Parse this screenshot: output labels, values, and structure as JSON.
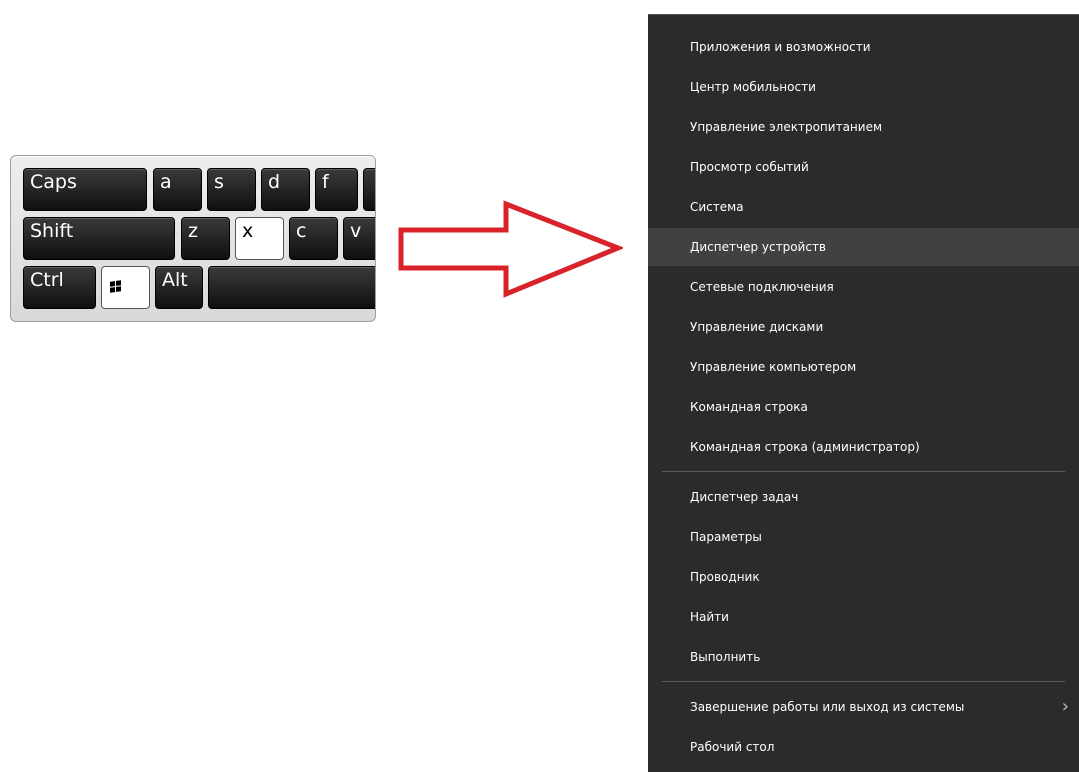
{
  "keyboard": {
    "row1": [
      "Caps",
      "a",
      "s",
      "d",
      "f"
    ],
    "row2": [
      "Shift",
      "z",
      "x",
      "c",
      "v"
    ],
    "row3": [
      "Ctrl",
      "Alt"
    ],
    "windows_key_icon": "windows-logo-icon"
  },
  "arrow": {
    "color": "#d9232a",
    "icon": "right-arrow-icon"
  },
  "menu": {
    "items": [
      "Приложения и возможности",
      "Центр мобильности",
      "Управление электропитанием",
      "Просмотр событий",
      "Система",
      "Диспетчер устройств",
      "Сетевые подключения",
      "Управление дисками",
      "Управление компьютером",
      "Командная строка",
      "Командная строка (администратор)",
      "Диспетчер задач",
      "Параметры",
      "Проводник",
      "Найти",
      "Выполнить",
      "Завершение работы или выход из системы",
      "Рабочий стол"
    ],
    "highlighted_item": "Диспетчер устройств",
    "submenu_icon": "chevron-right-icon",
    "background": "#2b2b2b"
  }
}
